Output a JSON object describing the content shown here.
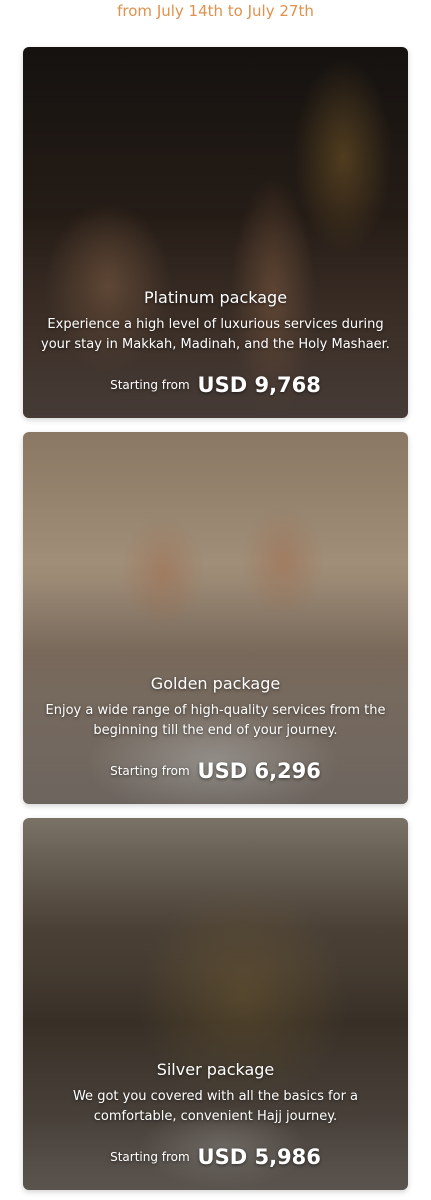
{
  "header": {
    "date_range": "from July 14th to July 27th"
  },
  "packages": [
    {
      "title": "Platinum package",
      "description": "Experience a high level of luxurious services during your stay in Makkah, Madinah, and the Holy Mashaer.",
      "price_prefix": "Starting from",
      "price": "USD 9,768"
    },
    {
      "title": "Golden package",
      "description": "Enjoy a wide range of high-quality services from the beginning till the end of your journey.",
      "price_prefix": "Starting from",
      "price": "USD 6,296"
    },
    {
      "title": "Silver package",
      "description": "We got you covered with all the basics for a comfortable, convenient Hajj journey.",
      "price_prefix": "Starting from",
      "price": "USD 5,986"
    }
  ],
  "colors": {
    "accent": "#e0914c",
    "text_on_image": "#ffffff"
  }
}
